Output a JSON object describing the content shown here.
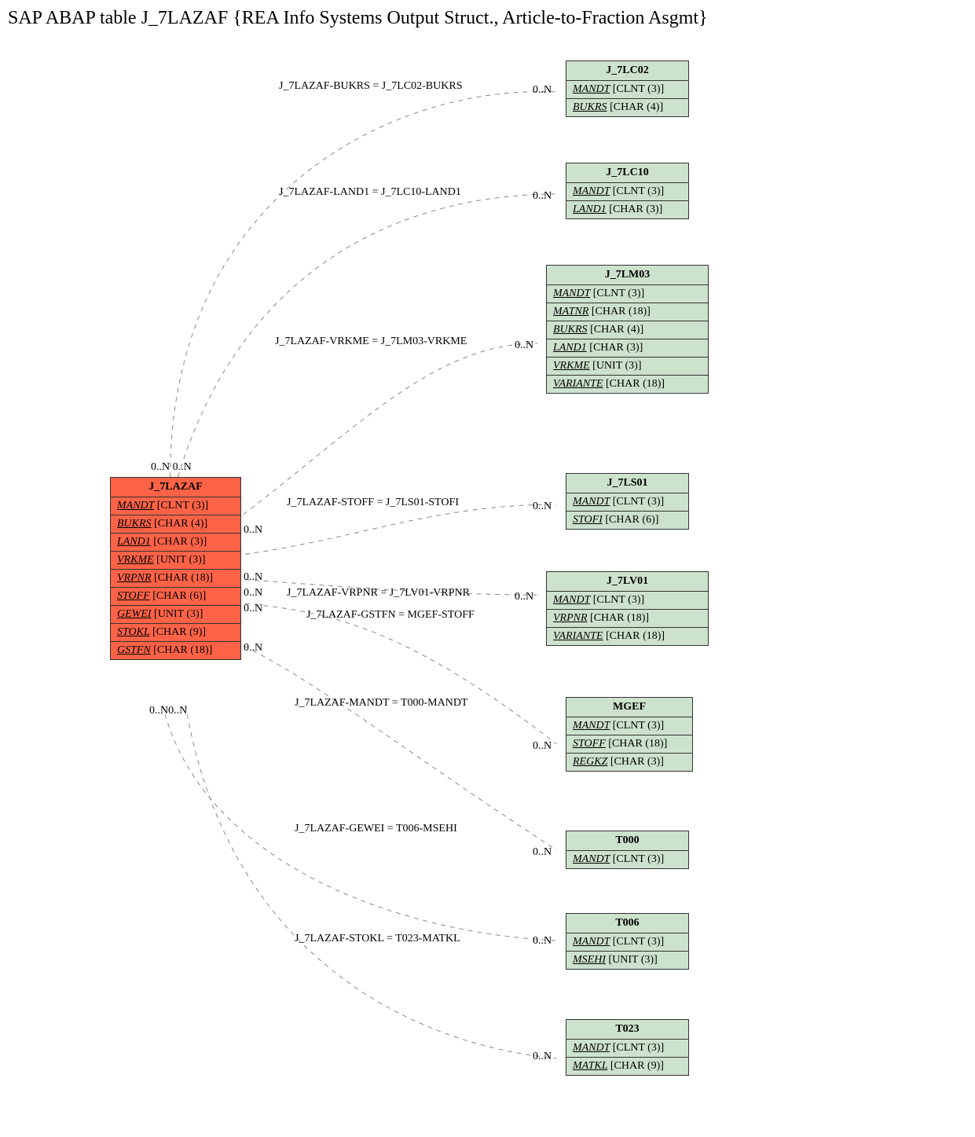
{
  "title": "SAP ABAP table J_7LAZAF {REA Info Systems Output Struct., Article-to-Fraction Asgmt}",
  "main": {
    "name": "J_7LAZAF",
    "fields": [
      {
        "name": "MANDT",
        "type": "[CLNT (3)]"
      },
      {
        "name": "BUKRS",
        "type": "[CHAR (4)]"
      },
      {
        "name": "LAND1",
        "type": "[CHAR (3)]"
      },
      {
        "name": "VRKME",
        "type": "[UNIT (3)]"
      },
      {
        "name": "VRPNR",
        "type": "[CHAR (18)]"
      },
      {
        "name": "STOFF",
        "type": "[CHAR (6)]"
      },
      {
        "name": "GEWEI",
        "type": "[UNIT (3)]"
      },
      {
        "name": "STOKL",
        "type": "[CHAR (9)]"
      },
      {
        "name": "GSTFN",
        "type": "[CHAR (18)]"
      }
    ]
  },
  "refs": {
    "j7lc02": {
      "name": "J_7LC02",
      "fields": [
        {
          "name": "MANDT",
          "type": "[CLNT (3)]"
        },
        {
          "name": "BUKRS",
          "type": "[CHAR (4)]"
        }
      ]
    },
    "j7lc10": {
      "name": "J_7LC10",
      "fields": [
        {
          "name": "MANDT",
          "type": "[CLNT (3)]"
        },
        {
          "name": "LAND1",
          "type": "[CHAR (3)]"
        }
      ]
    },
    "j7lm03": {
      "name": "J_7LM03",
      "fields": [
        {
          "name": "MANDT",
          "type": "[CLNT (3)]"
        },
        {
          "name": "MATNR",
          "type": "[CHAR (18)]"
        },
        {
          "name": "BUKRS",
          "type": "[CHAR (4)]"
        },
        {
          "name": "LAND1",
          "type": "[CHAR (3)]"
        },
        {
          "name": "VRKME",
          "type": "[UNIT (3)]"
        },
        {
          "name": "VARIANTE",
          "type": "[CHAR (18)]"
        }
      ]
    },
    "j7ls01": {
      "name": "J_7LS01",
      "fields": [
        {
          "name": "MANDT",
          "type": "[CLNT (3)]"
        },
        {
          "name": "STOFI",
          "type": "[CHAR (6)]"
        }
      ]
    },
    "j7lv01": {
      "name": "J_7LV01",
      "fields": [
        {
          "name": "MANDT",
          "type": "[CLNT (3)]"
        },
        {
          "name": "VRPNR",
          "type": "[CHAR (18)]"
        },
        {
          "name": "VARIANTE",
          "type": "[CHAR (18)]"
        }
      ]
    },
    "mgef": {
      "name": "MGEF",
      "fields": [
        {
          "name": "MANDT",
          "type": "[CLNT (3)]"
        },
        {
          "name": "STOFF",
          "type": "[CHAR (18)]"
        },
        {
          "name": "REGKZ",
          "type": "[CHAR (3)]"
        }
      ]
    },
    "t000": {
      "name": "T000",
      "fields": [
        {
          "name": "MANDT",
          "type": "[CLNT (3)]"
        }
      ]
    },
    "t006": {
      "name": "T006",
      "fields": [
        {
          "name": "MANDT",
          "type": "[CLNT (3)]"
        },
        {
          "name": "MSEHI",
          "type": "[UNIT (3)]"
        }
      ]
    },
    "t023": {
      "name": "T023",
      "fields": [
        {
          "name": "MANDT",
          "type": "[CLNT (3)]"
        },
        {
          "name": "MATKL",
          "type": "[CHAR (9)]"
        }
      ]
    }
  },
  "joins": {
    "j1": "J_7LAZAF-BUKRS = J_7LC02-BUKRS",
    "j2": "J_7LAZAF-LAND1 = J_7LC10-LAND1",
    "j3": "J_7LAZAF-VRKME = J_7LM03-VRKME",
    "j4": "J_7LAZAF-STOFF = J_7LS01-STOFI",
    "j5": "J_7LAZAF-VRPNR = J_7LV01-VRPNR",
    "j6": "J_7LAZAF-GSTFN = MGEF-STOFF",
    "j7": "J_7LAZAF-MANDT = T000-MANDT",
    "j8": "J_7LAZAF-GEWEI = T006-MSEHI",
    "j9": "J_7LAZAF-STOKL = T023-MATKL"
  },
  "card": {
    "zn": "0..N",
    "zn0n": "0..N0..N"
  }
}
